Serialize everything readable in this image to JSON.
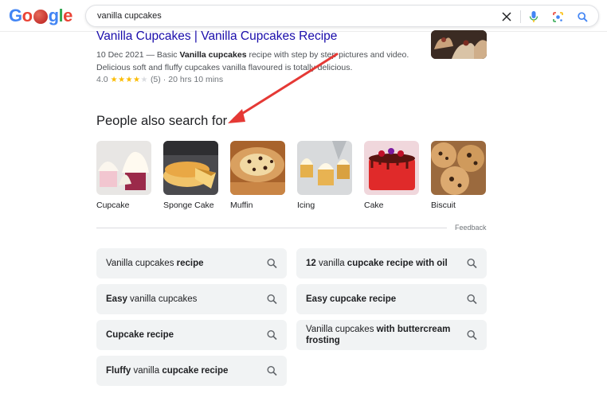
{
  "header": {
    "logo_text": "Google",
    "query": "vanilla cupcakes",
    "icons": [
      "clear-icon",
      "microphone-icon",
      "lens-icon",
      "search-icon"
    ]
  },
  "result": {
    "title": "Vanilla Cupcakes | Vanilla Cupcakes Recipe",
    "snippet_date": "10 Dec 2021 — Basic ",
    "snippet_bold": "Vanilla cupcakes",
    "snippet_rest": " recipe with step by step pictures and video.",
    "snippet_line2": "Delicious soft and fluffy cupcakes vanilla flavoured is totally delicious.",
    "rating": "4.0",
    "stars_filled": 4,
    "stars_total": 5,
    "reviews": "(5)",
    "separator": "·",
    "duration": "20 hrs 10 mins"
  },
  "pasf": {
    "title": "People also search for",
    "items": [
      {
        "label": "Cupcake"
      },
      {
        "label": "Sponge Cake"
      },
      {
        "label": "Muffin"
      },
      {
        "label": "Icing"
      },
      {
        "label": "Cake"
      },
      {
        "label": "Biscuit"
      }
    ],
    "feedback": "Feedback"
  },
  "related": [
    {
      "parts": [
        {
          "t": "Vanilla cupcakes ",
          "b": false
        },
        {
          "t": "recipe",
          "b": true
        }
      ]
    },
    {
      "parts": [
        {
          "t": "12",
          "b": true
        },
        {
          "t": " vanilla ",
          "b": false
        },
        {
          "t": "cupcake recipe with oil",
          "b": true
        }
      ]
    },
    {
      "parts": [
        {
          "t": "Easy",
          "b": true
        },
        {
          "t": " vanilla cupcakes",
          "b": false
        }
      ]
    },
    {
      "parts": [
        {
          "t": "Easy cupcake recipe",
          "b": true
        }
      ]
    },
    {
      "parts": [
        {
          "t": "Cupcake recipe",
          "b": true
        }
      ]
    },
    {
      "parts": [
        {
          "t": "Vanilla cupcakes ",
          "b": false
        },
        {
          "t": "with buttercream frosting",
          "b": true
        }
      ]
    },
    {
      "parts": [
        {
          "t": "Fluffy",
          "b": true
        },
        {
          "t": " vanilla ",
          "b": false
        },
        {
          "t": "cupcake recipe",
          "b": true
        }
      ]
    }
  ],
  "colors": {
    "link": "#1a0dab",
    "chip_bg": "#f1f3f4",
    "star": "#fbbc04",
    "annotation_arrow": "#e53935"
  }
}
